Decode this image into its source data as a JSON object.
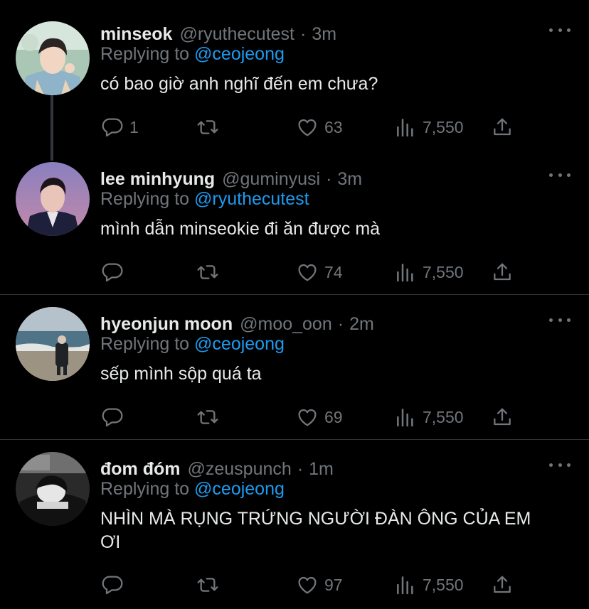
{
  "tweets": [
    {
      "name": "minseok",
      "handle": "@ryuthecutest",
      "time": "3m",
      "replying_prefix": "Replying to ",
      "replying_to": "@ceojeong",
      "text": "có bao giờ anh nghĩ đến em chưa?",
      "replies": "1",
      "likes": "63",
      "views": "7,550"
    },
    {
      "name": "lee minhyung",
      "handle": "@guminyusi",
      "time": "3m",
      "replying_prefix": "Replying to ",
      "replying_to": "@ryuthecutest",
      "text": "mình dẫn minseokie đi ăn được mà",
      "replies": "",
      "likes": "74",
      "views": "7,550"
    },
    {
      "name": "hyeonjun moon",
      "handle": "@moo_oon",
      "time": "2m",
      "replying_prefix": "Replying to ",
      "replying_to": "@ceojeong",
      "text": "sếp mình sộp quá ta",
      "replies": "",
      "likes": "69",
      "views": "7,550"
    },
    {
      "name": "đom đóm",
      "handle": "@zeuspunch",
      "time": "1m",
      "replying_prefix": "Replying to ",
      "replying_to": "@ceojeong",
      "text": "NHÌN MÀ RỤNG TRỨNG NGƯỜI ĐÀN ÔNG CỦA EM ƠI",
      "replies": "",
      "likes": "97",
      "views": "7,550"
    }
  ],
  "separator": "·",
  "colors": {
    "background": "#000000",
    "text_primary": "#e7e9ea",
    "text_secondary": "#71767b",
    "link": "#1d9bf0",
    "divider": "#2f3336"
  },
  "icons": [
    "reply-icon",
    "retweet-icon",
    "like-icon",
    "views-icon",
    "share-icon",
    "more-icon"
  ]
}
